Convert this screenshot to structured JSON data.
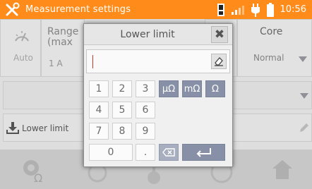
{
  "statusbar": {
    "title": "Measurement settings",
    "time": "10:56",
    "color": "#ff8c1a"
  },
  "background": {
    "auto_label": "Auto",
    "range_header": "Range (max",
    "range_value": "1 A",
    "core_header": "Core",
    "core_value": "Normal",
    "partial_char": "t",
    "lower_limit_label": "Lower limit"
  },
  "dialog": {
    "title": "Lower limit",
    "input_value": "",
    "keys": {
      "k1": "1",
      "k2": "2",
      "k3": "3",
      "k4": "4",
      "k5": "5",
      "k6": "6",
      "k7": "7",
      "k8": "8",
      "k9": "9",
      "k0": "0",
      "dot": "."
    },
    "units": [
      "µΩ",
      "mΩ",
      "Ω"
    ]
  },
  "icons": {
    "app": "wrench-screwdriver-icon",
    "battery": "battery-icon",
    "signal": "signal-bars-icon",
    "plug": "power-plug-icon",
    "sd": "sd-card-icon",
    "close": "close-icon",
    "eraser": "eraser-icon",
    "backspace": "backspace-icon",
    "enter": "enter-icon",
    "download": "download-icon",
    "pencil": "pencil-icon",
    "home": "home-icon"
  }
}
